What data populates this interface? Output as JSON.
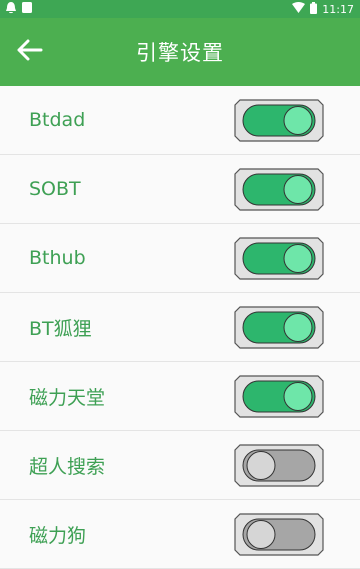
{
  "status_bar": {
    "time": "11:17",
    "icons": [
      "notification-icon",
      "sim-icon",
      "wifi-icon",
      "battery-icon"
    ]
  },
  "app_bar": {
    "title": "引擎设置",
    "back_icon": "back-arrow-icon"
  },
  "engines": [
    {
      "label": "Btdad",
      "enabled": true
    },
    {
      "label": "SOBT",
      "enabled": true
    },
    {
      "label": "Bthub",
      "enabled": true
    },
    {
      "label": "BT狐狸",
      "enabled": true
    },
    {
      "label": "磁力天堂",
      "enabled": true
    },
    {
      "label": "超人搜索",
      "enabled": false
    },
    {
      "label": "磁力狗",
      "enabled": false
    }
  ],
  "colors": {
    "appbar": "#4caf50",
    "statusbar": "#3ea754",
    "label_text": "#3ea054",
    "toggle_on_track": "#2db66d",
    "toggle_on_knob": "#6ee6a9",
    "toggle_off_track": "#a6a6a6",
    "toggle_off_knob": "#d6d6d6"
  }
}
